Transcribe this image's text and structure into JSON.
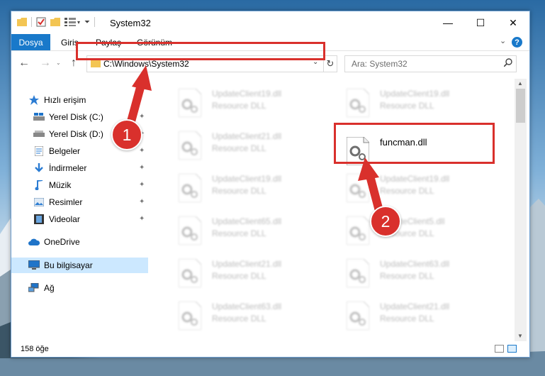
{
  "window": {
    "title": "System32",
    "controls": {
      "minimize": "—",
      "maximize": "☐",
      "close": "✕"
    }
  },
  "ribbon": {
    "tabs": [
      "Dosya",
      "Giriş",
      "Paylaş",
      "Görünüm"
    ],
    "help": "?"
  },
  "navigation": {
    "back": "←",
    "forward": "→",
    "up": "↑",
    "address": "C:\\Windows\\System32",
    "refresh": "↻",
    "search_placeholder": "Ara: System32"
  },
  "sidebar": {
    "items": [
      {
        "label": "Hızlı erişim",
        "icon": "star-icon",
        "pinned": false
      },
      {
        "label": "Yerel Disk (C:)",
        "icon": "drive-icon",
        "pinned": true
      },
      {
        "label": "Yerel Disk (D:)",
        "icon": "drive-icon",
        "pinned": true
      },
      {
        "label": "Belgeler",
        "icon": "documents-icon",
        "pinned": true
      },
      {
        "label": "İndirmeler",
        "icon": "download-icon",
        "pinned": true
      },
      {
        "label": "Müzik",
        "icon": "music-icon",
        "pinned": true
      },
      {
        "label": "Resimler",
        "icon": "pictures-icon",
        "pinned": true
      },
      {
        "label": "Videolar",
        "icon": "videos-icon",
        "pinned": true
      },
      {
        "label": "OneDrive",
        "icon": "cloud-icon",
        "pinned": false
      },
      {
        "label": "Bu bilgisayar",
        "icon": "computer-icon",
        "pinned": false,
        "selected": true
      },
      {
        "label": "Ağ",
        "icon": "network-icon",
        "pinned": false
      }
    ]
  },
  "files": [
    {
      "name": "UpdateClient19.dll",
      "type": "Resource DLL",
      "blurred": true
    },
    {
      "name": "UpdateClient19.dll",
      "type": "Resource DLL",
      "blurred": true
    },
    {
      "name": "UpdateClient21.dll",
      "type": "Resource DLL",
      "blurred": true
    },
    {
      "name": "funcman.dll",
      "type": "",
      "blurred": false,
      "highlighted": true
    },
    {
      "name": "UpdateClient19.dll",
      "type": "Resource DLL",
      "blurred": true
    },
    {
      "name": "UpdateClient19.dll",
      "type": "Resource DLL",
      "blurred": true
    },
    {
      "name": "UpdateClient65.dll",
      "type": "Resource DLL",
      "blurred": true
    },
    {
      "name": "UpdateClient5.dll",
      "type": "Resource DLL",
      "blurred": true
    },
    {
      "name": "UpdateClient21.dll",
      "type": "Resource DLL",
      "blurred": true
    },
    {
      "name": "UpdateClient63.dll",
      "type": "Resource DLL",
      "blurred": true
    },
    {
      "name": "UpdateClient63.dll",
      "type": "Resource DLL",
      "blurred": true
    },
    {
      "name": "UpdateClient21.dll",
      "type": "Resource DLL",
      "blurred": true
    }
  ],
  "status": {
    "item_count": "158 öğe"
  },
  "annotations": {
    "step1": "1",
    "step2": "2",
    "color": "#d9302c"
  }
}
